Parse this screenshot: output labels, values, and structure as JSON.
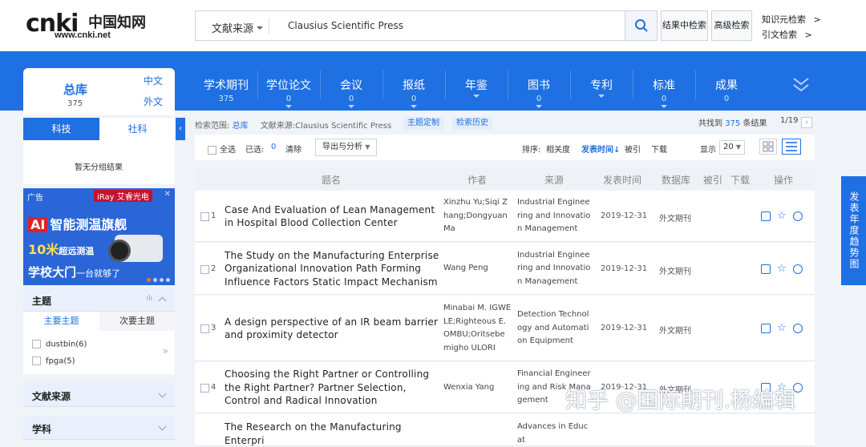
{
  "logo": {
    "mark": "cnki",
    "cn": "中国知网",
    "url": "www.cnki.net"
  },
  "search": {
    "source": "文献来源",
    "query": "Clausius Scientific Press"
  },
  "header_buttons": {
    "in_result": "结果中检索",
    "advanced": "高级检索"
  },
  "header_links": {
    "knowledge": "知识元检索",
    "citation": "引文检索"
  },
  "nav_tabs": [
    {
      "label": "学术期刊",
      "count": "375"
    },
    {
      "label": "学位论文",
      "count": "0"
    },
    {
      "label": "会议",
      "count": "0"
    },
    {
      "label": "报纸",
      "count": "0"
    },
    {
      "label": "年鉴",
      "count": ""
    },
    {
      "label": "图书",
      "count": "0"
    },
    {
      "label": "专利",
      "count": ""
    },
    {
      "label": "标准",
      "count": "0"
    },
    {
      "label": "成果",
      "count": "0"
    }
  ],
  "sidebar": {
    "total_label": "总库",
    "total_count": "375",
    "lang_cn": "中文",
    "lang_en": "外文",
    "tab_sci": "科技",
    "tab_soc": "社科",
    "no_group": "暂无分组结果",
    "ad": {
      "tag": "广告",
      "brand": "iRay 艾睿光电",
      "line1_badge": "AI",
      "line1": "智能测温旗舰",
      "line2": "10米",
      "line2_sub": "超远测温",
      "line3": "学校大门",
      "line3_sub": "一台就够了"
    },
    "topic_header": "主题",
    "topic_tab_main": "主要主题",
    "topic_tab_sub": "次要主题",
    "topics": [
      {
        "label": "dustbin(6)"
      },
      {
        "label": "fpga(5)"
      }
    ],
    "source_header": "文献来源",
    "subject_header": "学科"
  },
  "info": {
    "scope_label": "检索范围:",
    "scope": "总库",
    "source_label": "文献来源:",
    "source": "Clausius Scientific Press",
    "btn_topic": "主题定制",
    "btn_history": "检索历史",
    "found_prefix": "共找到",
    "found": "375",
    "found_suffix": "条结果",
    "page": "1/19"
  },
  "toolbar": {
    "select_all": "全选",
    "selected_label": "已选:",
    "selected": "0",
    "clear": "清除",
    "export": "导出与分析",
    "sort_label": "排序:",
    "sort_rel": "相关度",
    "sort_date": "发表时间",
    "sort_cite": "被引",
    "sort_dl": "下载",
    "show_label": "显示",
    "show_num": "20"
  },
  "columns": {
    "title": "题名",
    "author": "作者",
    "source": "来源",
    "date": "发表时间",
    "db": "数据库",
    "cited": "被引",
    "dl": "下载",
    "ops": "操作"
  },
  "rows": [
    {
      "no": "1",
      "title": "Case And Evaluation of Lean Management in Hospital Blood Collection Center",
      "author": "Xinzhu Yu;Siqi Zhang;Dongyuan Ma",
      "source": "Industrial Engineering and Innovation Management",
      "date": "2019-12-31",
      "db": "外文期刊"
    },
    {
      "no": "2",
      "title": "The Study on the Manufacturing Enterprise Organizational Innovation Path Forming Influence Factors Static Impact Mechanism",
      "author": "Wang Peng",
      "source": "Industrial Engineering and Innovation Management",
      "date": "2019-12-31",
      "db": "外文期刊"
    },
    {
      "no": "3",
      "title": "A design perspective of an IR beam barrier and proximity detector",
      "author": "Minabai M. IGWELE;Righteous E. OMBU;Oritsebemigho ULORI",
      "source": "Detection Technology and Automation Equipment",
      "date": "2019-12-31",
      "db": "外文期刊"
    },
    {
      "no": "4",
      "title": "Choosing the Right Partner or Controlling the Right Partner? Partner Selection, Control and Radical Innovation",
      "author": "Wenxia Yang",
      "source": "Financial Engineering and Risk Management",
      "date": "2019-12-31",
      "db": "外文期刊"
    },
    {
      "no": "5",
      "title": "The Research on the Manufacturing Enterpri",
      "author": "",
      "source": "Advances in Educat",
      "date": "",
      "db": ""
    }
  ],
  "trend": "发表年度趋势图",
  "watermark": "知乎 @国际期刊.杨编辑",
  "colors": {
    "brand_blue": "#1f70e2",
    "bg": "#f0f3f7"
  }
}
